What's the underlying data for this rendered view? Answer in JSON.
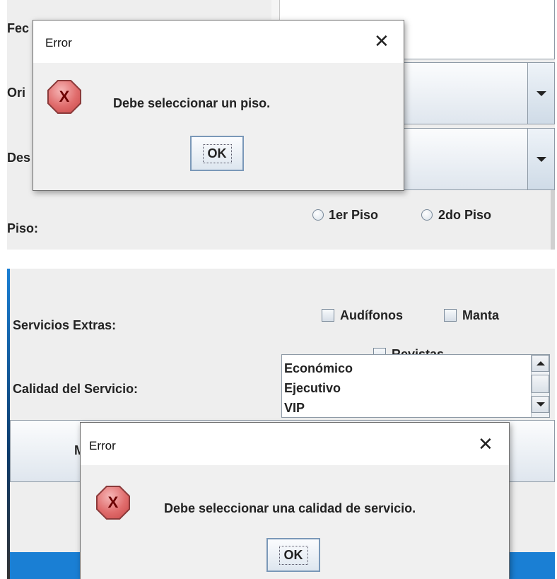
{
  "top": {
    "labels": {
      "fecha": "Fec",
      "origen": "Ori",
      "destino": "Des",
      "piso": "Piso:"
    },
    "piso_options": [
      "1er Piso",
      "2do Piso"
    ],
    "dialog": {
      "title": "Error",
      "message": "Debe seleccionar un piso.",
      "ok_label": "OK",
      "icon_letter": "X"
    }
  },
  "bottom": {
    "labels": {
      "servicios": "Servicios Extras:",
      "calidad": "Calidad del Servicio:"
    },
    "servicios_options": [
      "Audífonos",
      "Manta",
      "Revistas"
    ],
    "calidad_options": [
      "Económico",
      "Ejecutivo",
      "VIP"
    ],
    "button_fragment": "M",
    "dialog": {
      "title": "Error",
      "message": "Debe seleccionar una calidad de servicio.",
      "ok_label": "OK",
      "icon_letter": "X"
    }
  },
  "colors": {
    "panel_bg": "#eeeeee",
    "dialog_bg": "#f0f0f0",
    "error_icon": "#e06c6c",
    "taskbar": "#1a7fd4"
  }
}
